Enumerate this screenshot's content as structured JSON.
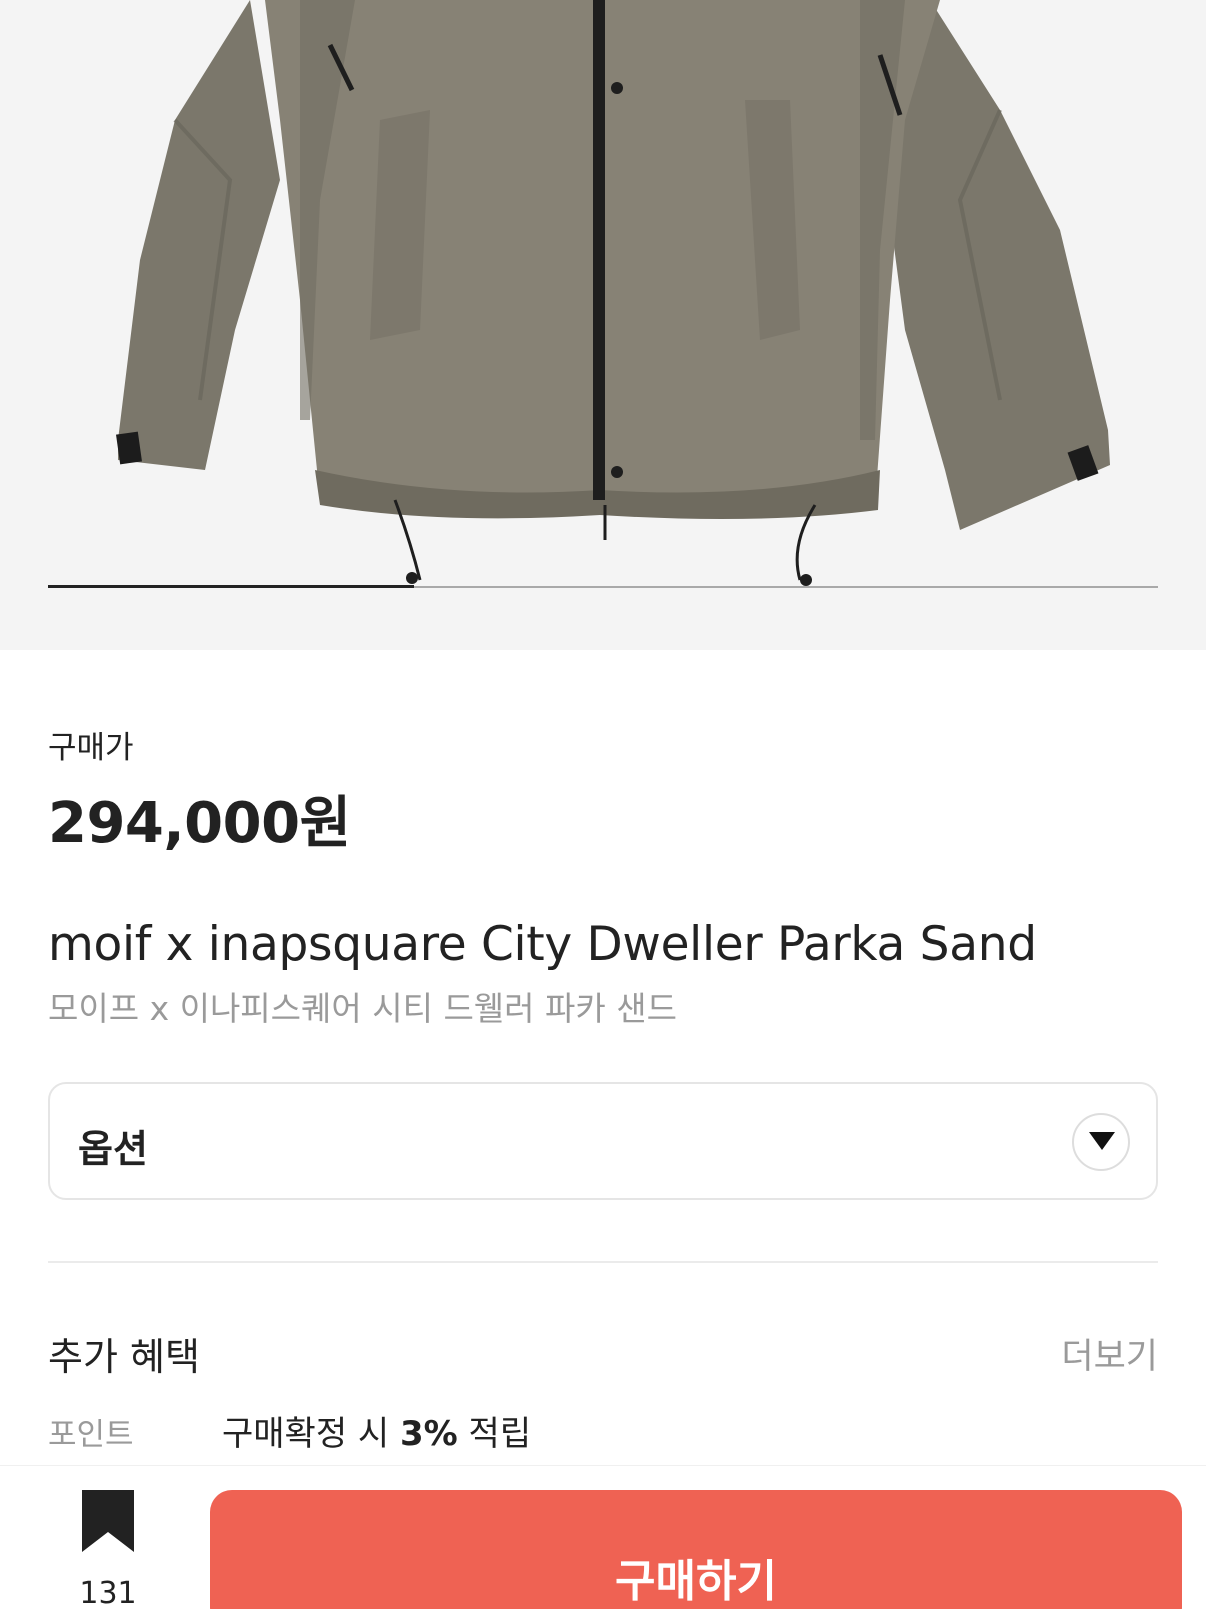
{
  "product_image": {
    "alt_subject": "jacket",
    "slide_progress": 0.33
  },
  "price": {
    "label": "구매가",
    "value": "294,000원"
  },
  "product": {
    "title_en": "moif x inapsquare City Dweller Parka Sand",
    "title_ko": "모이프 x 이나피스퀘어 시티 드웰러 파카 샌드"
  },
  "option": {
    "label": "옵션"
  },
  "benefits": {
    "title": "추가 혜택",
    "more_label": "더보기",
    "point_label": "포인트",
    "point_prefix": "구매확정 시 ",
    "point_rate": "3%",
    "point_suffix": " 적립"
  },
  "bottom_bar": {
    "bookmark_count": "131",
    "buy_label": "구매하기"
  },
  "colors": {
    "accent": "#ef6253",
    "jacket": "#7a7568"
  }
}
